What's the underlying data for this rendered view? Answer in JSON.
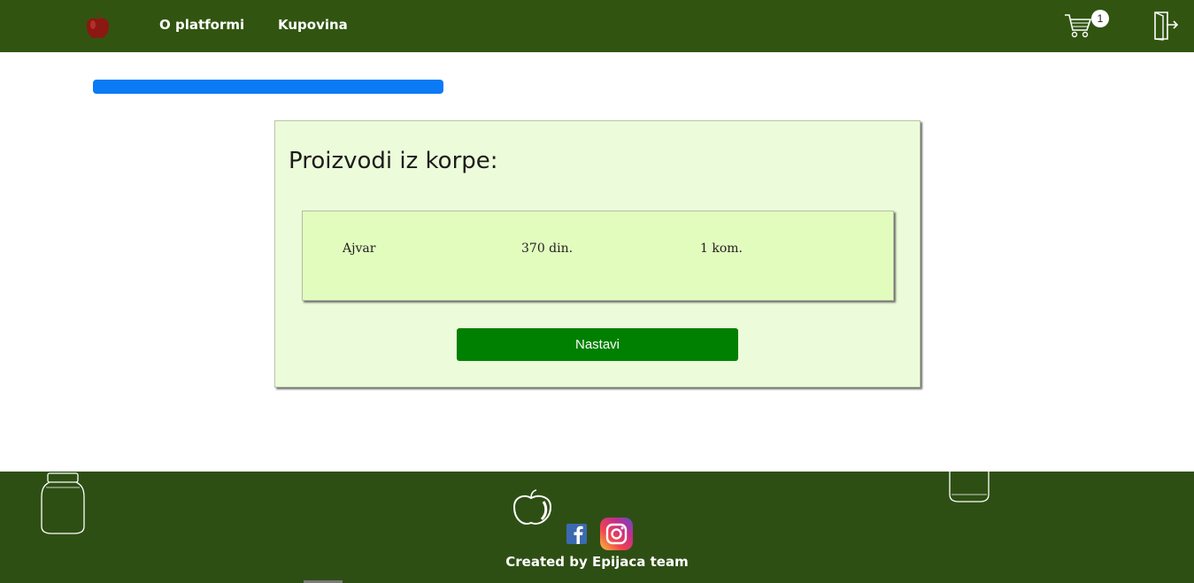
{
  "nav": {
    "links": [
      {
        "label": "O platformi"
      },
      {
        "label": "Kupovina"
      }
    ],
    "cart_count": "1",
    "colors": {
      "bar": "#315510",
      "text": "#ffffff"
    },
    "icons": [
      "apple-logo-icon",
      "cart-icon",
      "logout-door-icon"
    ]
  },
  "progress": {
    "fraction": 0.29,
    "color": "#0a7af5"
  },
  "main": {
    "title": "Proizvodi iz korpe:",
    "items": [
      {
        "name": "Ajvar",
        "price": "370 din.",
        "qty": "1 kom."
      }
    ],
    "continue_label": "Nastavi",
    "colors": {
      "panel": "#ecfbd9",
      "item": "#e2fcbe",
      "button": "#008000"
    }
  },
  "footer": {
    "credit": "Created by Epijaca team",
    "colors": {
      "background": "#2e4f14"
    },
    "icons": [
      "jar-icon",
      "apple-outline-icon",
      "facebook-icon",
      "instagram-icon"
    ]
  }
}
